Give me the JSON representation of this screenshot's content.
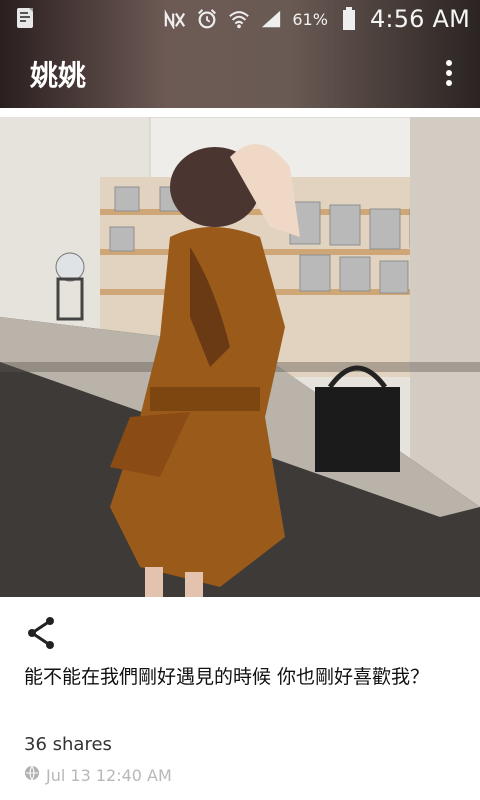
{
  "status_bar": {
    "battery_percent": "61%",
    "time": "4:56 AM",
    "icons": [
      "notification-icon",
      "signal-muted-icon",
      "alarm-icon",
      "wifi-icon",
      "cell-signal-icon",
      "battery-icon"
    ]
  },
  "app_bar": {
    "title": "姚姚",
    "overflow_icon": "more-vert-icon"
  },
  "post": {
    "caption": "能不能在我們剛好遇見的時候 你也剛好喜歡我？",
    "shares": "36 shares",
    "timestamp": "Jul 13 12:40 AM",
    "share_icon": "share-icon",
    "visibility_icon": "globe-icon"
  }
}
